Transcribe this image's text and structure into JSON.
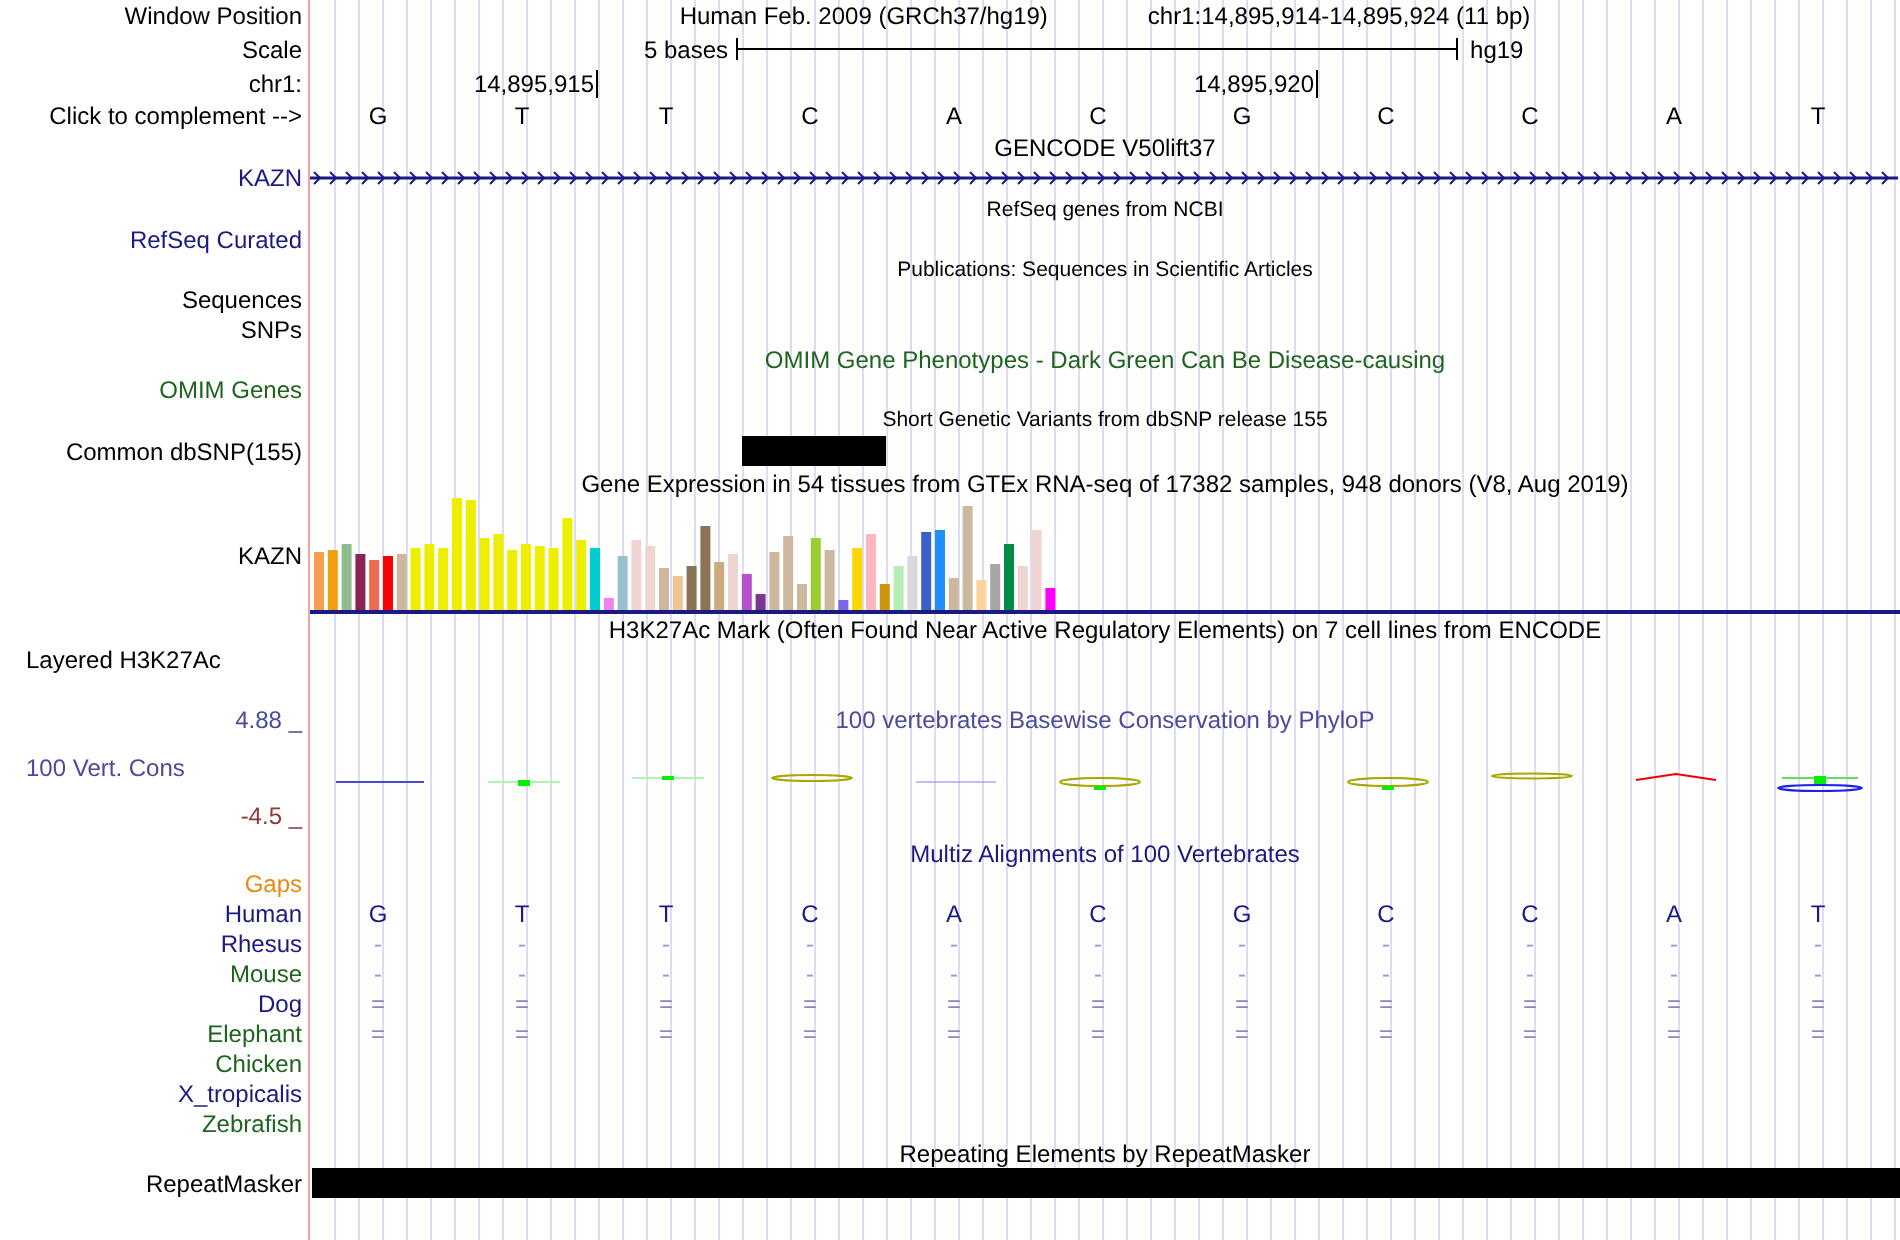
{
  "header": {
    "label": "Window Position",
    "assembly": "Human Feb. 2009 (GRCh37/hg19)",
    "position": "chr1:14,895,914-14,895,924 (11 bp)"
  },
  "scale": {
    "label": "Scale",
    "size": "5 bases",
    "assembly": "hg19"
  },
  "coordinates": {
    "label": "chr1:",
    "ticks": [
      "14,895,915",
      "14,895,920"
    ]
  },
  "sequence": {
    "label": "Click to complement -->",
    "bases": [
      "G",
      "T",
      "T",
      "C",
      "A",
      "C",
      "G",
      "C",
      "C",
      "A",
      "T"
    ]
  },
  "tracks": [
    {
      "kind": "title",
      "text": "GENCODE V50lift37",
      "color": "#000000"
    },
    {
      "kind": "gene",
      "label": "KAZN",
      "color": "#1a1a80"
    },
    {
      "kind": "caption",
      "text": "RefSeq genes from NCBI"
    },
    {
      "kind": "label",
      "label": "RefSeq Curated",
      "color": "#1a1a80"
    },
    {
      "kind": "caption",
      "text": "Publications: Sequences in Scientific Articles"
    },
    {
      "kind": "label",
      "label": "Sequences",
      "color": "#000000"
    },
    {
      "kind": "label",
      "label": "SNPs",
      "color": "#000000"
    },
    {
      "kind": "title",
      "text": "OMIM Gene Phenotypes - Dark Green Can Be Disease-causing",
      "color": "#1e641e"
    },
    {
      "kind": "label",
      "label": "OMIM Genes",
      "color": "#1e641e"
    },
    {
      "kind": "caption",
      "text": "Short Genetic Variants from dbSNP release 155"
    },
    {
      "kind": "variant",
      "label": "Common dbSNP(155)",
      "color": "#000000"
    },
    {
      "kind": "title",
      "text": "Gene Expression in 54 tissues from GTEx RNA-seq of 17382 samples, 948 donors (V8, Aug 2019)",
      "color": "#000000"
    },
    {
      "kind": "expression",
      "label": "KAZN",
      "color": "#000000"
    },
    {
      "kind": "title",
      "text": "H3K27Ac Mark (Often Found Near Active Regulatory Elements) on 7 cell lines from ENCODE",
      "color": "#000000"
    },
    {
      "kind": "signal",
      "label": "Layered H3K27Ac",
      "color": "#000000"
    },
    {
      "kind": "conservation",
      "title": {
        "text": "100 vertebrates Basewise Conservation by PhyloP",
        "color": "#4a4a9a"
      },
      "label": {
        "text": "100 Vert. Cons",
        "color": "#4a4a9a"
      },
      "max": {
        "text": "4.88 _",
        "color": "#4a4a9a"
      },
      "min": {
        "text": "-4.5 _",
        "color": "#8b3a3a"
      }
    },
    {
      "kind": "title",
      "text": "Multiz Alignments of 100 Vertebrates",
      "color": "#1a1a80"
    },
    {
      "kind": "label",
      "label": "Gaps",
      "color": "#e88a10"
    },
    {
      "kind": "alignment",
      "species": [
        {
          "name": "Human",
          "color": "#1a1a80",
          "bases": {
            "color": "#1a1a80",
            "letters": [
              "G",
              "T",
              "T",
              "C",
              "A",
              "C",
              "G",
              "C",
              "C",
              "A",
              "T"
            ]
          }
        },
        {
          "name": "Rhesus",
          "color": "#1a1a80",
          "bases": {
            "color": "#9a9ac8",
            "letters": [
              "-",
              "-",
              "-",
              "-",
              "-",
              "-",
              "-",
              "-",
              "-",
              "-",
              "-"
            ]
          }
        },
        {
          "name": "Mouse",
          "color": "#1e641e",
          "bases": {
            "color": "#9a9ac8",
            "letters": [
              "-",
              "-",
              "-",
              "-",
              "-",
              "-",
              "-",
              "-",
              "-",
              "-",
              "-"
            ]
          }
        },
        {
          "name": "Dog",
          "color": "#1a1a80",
          "bases": {
            "color": "#8a8ac0",
            "letters": [
              "=",
              "=",
              "=",
              "=",
              "=",
              "=",
              "=",
              "=",
              "=",
              "=",
              "="
            ]
          }
        },
        {
          "name": "Elephant",
          "color": "#1e641e",
          "bases": {
            "color": "#8a8ac0",
            "letters": [
              "=",
              "=",
              "=",
              "=",
              "=",
              "=",
              "=",
              "=",
              "=",
              "=",
              "="
            ]
          }
        },
        {
          "name": "Chicken",
          "color": "#1e641e"
        },
        {
          "name": "X_tropicalis",
          "color": "#1a1a80"
        },
        {
          "name": "Zebrafish",
          "color": "#1e641e"
        }
      ]
    },
    {
      "kind": "title",
      "text": "Repeating Elements by RepeatMasker",
      "color": "#000000"
    },
    {
      "kind": "repeat",
      "label": "RepeatMasker",
      "color": "#000000"
    }
  ]
}
